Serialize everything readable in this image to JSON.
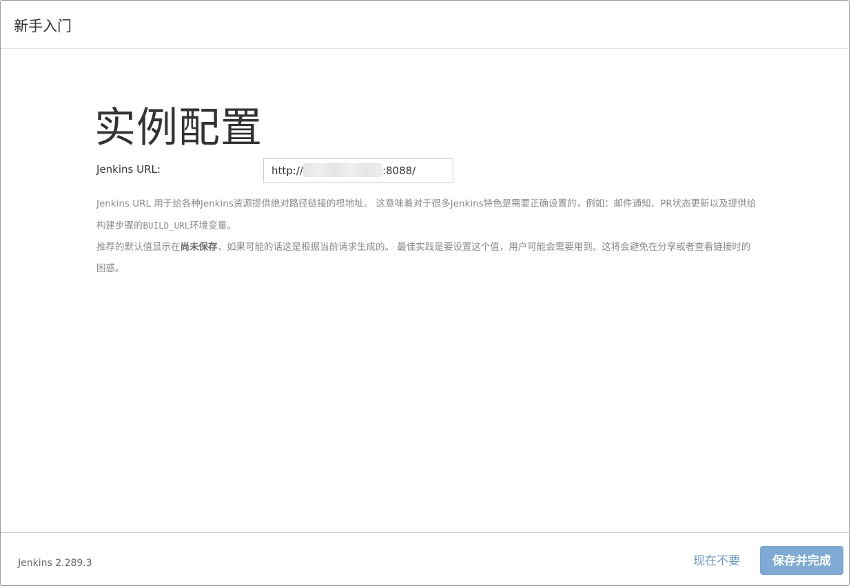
{
  "header": {
    "title": "新手入门"
  },
  "main": {
    "page_title": "实例配置",
    "url_label": "Jenkins URL:",
    "url_value_prefix": "http://",
    "url_value_suffix": ":8088/",
    "help": {
      "p1_text": "Jenkins URL 用于给各种Jenkins资源提供绝对路径链接的根地址。 这意味着对于很多Jenkins特色是需要正确设置的，例如：邮件通知、PR状态更新以及提供给构建步骤的",
      "p1_code": "BUILD_URL",
      "p1_tail": "环境变量。",
      "p2_head": "推荐的默认值显示在",
      "p2_bold": "尚未保存",
      "p2_tail": "，如果可能的话这是根据当前请求生成的。 最佳实践是要设置这个值，用户可能会需要用到。这将会避免在分享或者查看链接时的困惑。"
    }
  },
  "footer": {
    "version": "Jenkins 2.289.3",
    "skip_label": "现在不要",
    "save_label": "保存并完成"
  },
  "colors": {
    "primary_button": "#7eaad3",
    "link": "#6f9bc4"
  }
}
